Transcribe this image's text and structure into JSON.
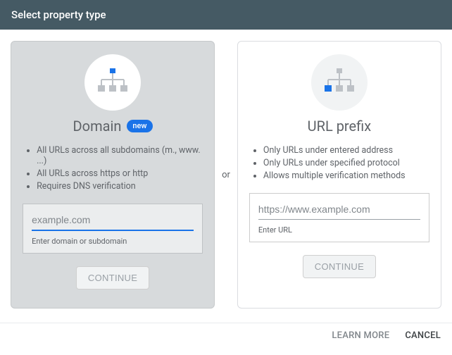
{
  "header": {
    "title": "Select property type"
  },
  "separator": "or",
  "domain_card": {
    "title": "Domain",
    "badge": "new",
    "features": [
      "All URLs across all subdomains (m., www. ...)",
      "All URLs across https or http",
      "Requires DNS verification"
    ],
    "input": {
      "value": "",
      "placeholder": "example.com",
      "helper": "Enter domain or subdomain"
    },
    "button": "CONTINUE",
    "icon": "sitemap-icon",
    "icon_accent_index": 0
  },
  "url_card": {
    "title": "URL prefix",
    "features": [
      "Only URLs under entered address",
      "Only URLs under specified protocol",
      "Allows multiple verification methods"
    ],
    "input": {
      "value": "",
      "placeholder": "https://www.example.com",
      "helper": "Enter URL"
    },
    "button": "CONTINUE",
    "icon": "sitemap-icon",
    "icon_accent_index": 1
  },
  "footer": {
    "learn_more": "LEARN MORE",
    "cancel": "CANCEL"
  },
  "colors": {
    "accent": "#1a73e8",
    "header_bg": "#455a64",
    "muted": "#5f6368"
  }
}
